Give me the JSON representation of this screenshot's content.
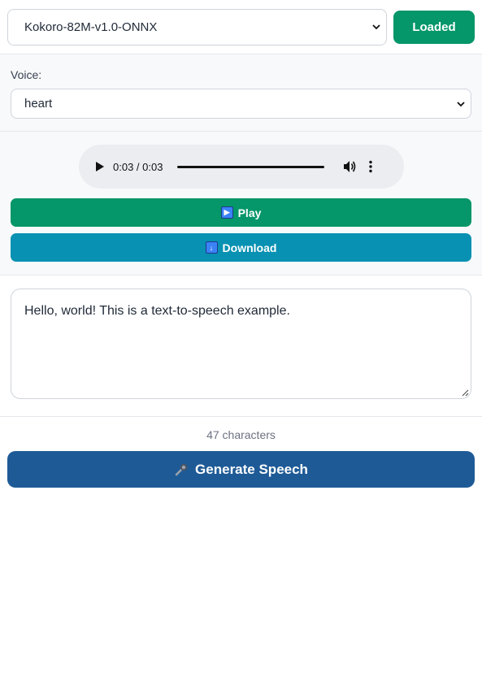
{
  "model": {
    "selected": "Kokoro-82M-v1.0-ONNX",
    "status_label": "Loaded"
  },
  "voice": {
    "label": "Voice:",
    "selected": "heart"
  },
  "audio": {
    "time": "0:03 / 0:03",
    "progress": 1.0
  },
  "actions": {
    "play_label": "Play",
    "play_icon": "play-button-emoji",
    "download_label": "Download",
    "download_icon": "down-arrow-emoji"
  },
  "text_input": {
    "value": "Hello, world! This is a text-to-speech example."
  },
  "char_count": "47 characters",
  "generate": {
    "label": "Generate Speech",
    "icon": "microphone-emoji"
  },
  "colors": {
    "green": "#059669",
    "cyan": "#0891b2",
    "navy": "#1e5a96"
  }
}
